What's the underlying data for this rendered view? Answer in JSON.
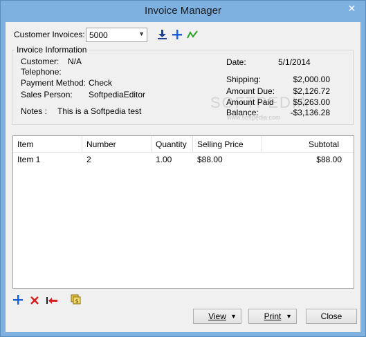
{
  "window": {
    "title": "Invoice Manager",
    "close_glyph": "✕"
  },
  "header": {
    "customer_invoices_label": "Customer Invoices:",
    "invoice_selected": "5000",
    "download_icon": "download-icon",
    "add_icon": "plus-icon",
    "chart_icon": "trend-icon"
  },
  "invoice_info": {
    "title": "Invoice Information",
    "customer_label": "Customer:",
    "customer_value": "N/A",
    "telephone_label": "Telephone:",
    "telephone_value": "",
    "payment_label": "Payment Method:",
    "payment_value": "Check",
    "salesperson_label": "Sales Person:",
    "salesperson_value": "SoftpediaEditor",
    "notes_label": "Notes :",
    "notes_value": "This is a Softpedia test",
    "date_label": "Date:",
    "date_value": "5/1/2014",
    "shipping_label": "Shipping:",
    "shipping_value": "$2,000.00",
    "amount_due_label": "Amount Due:",
    "amount_due_value": "$2,126.72",
    "amount_paid_label": "Amount Paid",
    "amount_paid_value": "$5,263.00",
    "balance_label": "Balance:",
    "balance_value": "-$3,136.28"
  },
  "watermark": {
    "text": "SOFTPEDIA",
    "sub": "www.softpedia.com"
  },
  "items_table": {
    "columns": [
      "Item",
      "Number",
      "Quantity",
      "Selling Price",
      "Subtotal"
    ],
    "rows": [
      [
        "Item 1",
        "2",
        "1.00",
        "$88.00",
        "$88.00"
      ]
    ]
  },
  "bottom_toolbar": {
    "add_icon": "plus-icon",
    "delete_icon": "delete-x-icon",
    "remove_icon": "remove-arrow-icon",
    "payment_icon": "payment-icon"
  },
  "buttons": {
    "view_label": "View",
    "print_label": "Print",
    "close_label": "Close"
  }
}
